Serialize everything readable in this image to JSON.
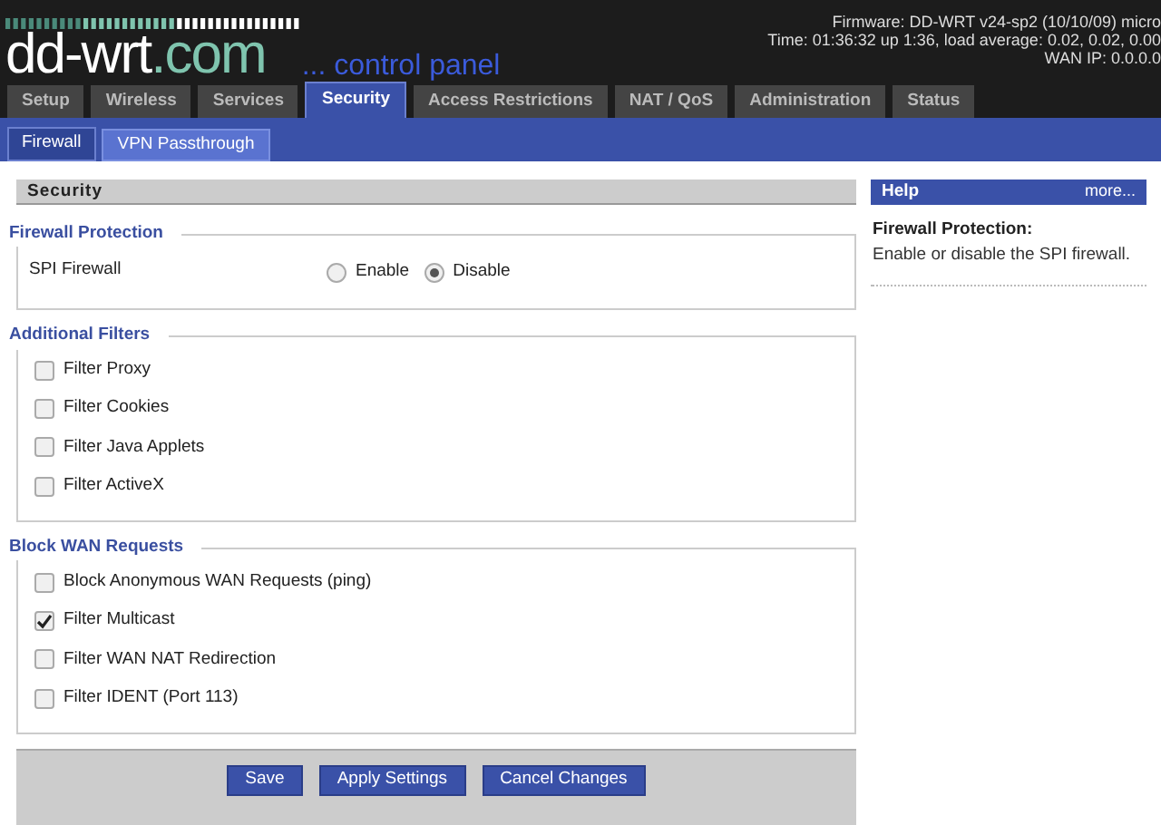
{
  "header": {
    "logo_main": "dd-wrt",
    "logo_suffix": ".com",
    "tagline": "... control panel",
    "info": [
      "Firmware: DD-WRT v24-sp2 (10/10/09) micro",
      "Time: 01:36:32 up 1:36, load average: 0.02, 0.02, 0.00",
      "WAN IP: 0.0.0.0"
    ]
  },
  "tabs": [
    {
      "label": "Setup",
      "selected": false
    },
    {
      "label": "Wireless",
      "selected": false
    },
    {
      "label": "Services",
      "selected": false
    },
    {
      "label": "Security",
      "selected": true
    },
    {
      "label": "Access Restrictions",
      "selected": false
    },
    {
      "label": "NAT / QoS",
      "selected": false
    },
    {
      "label": "Administration",
      "selected": false
    },
    {
      "label": "Status",
      "selected": false
    }
  ],
  "subtabs": [
    {
      "label": "Firewall",
      "selected": true
    },
    {
      "label": "VPN Passthrough",
      "selected": false
    }
  ],
  "section_title": "Security",
  "groups": [
    {
      "legend": "Firewall Protection",
      "kind": "radio",
      "label": "SPI Firewall",
      "options": [
        {
          "label": "Enable",
          "selected": false
        },
        {
          "label": "Disable",
          "selected": true
        }
      ]
    },
    {
      "legend": "Additional Filters",
      "kind": "checkboxes",
      "items": [
        {
          "label": "Filter Proxy",
          "checked": false
        },
        {
          "label": "Filter Cookies",
          "checked": false
        },
        {
          "label": "Filter Java Applets",
          "checked": false
        },
        {
          "label": "Filter ActiveX",
          "checked": false
        }
      ]
    },
    {
      "legend": "Block WAN Requests",
      "kind": "checkboxes",
      "items": [
        {
          "label": "Block Anonymous WAN Requests (ping)",
          "checked": false
        },
        {
          "label": "Filter Multicast",
          "checked": true
        },
        {
          "label": "Filter WAN NAT Redirection",
          "checked": false
        },
        {
          "label": "Filter IDENT (Port 113)",
          "checked": false
        }
      ]
    }
  ],
  "buttons": [
    "Save",
    "Apply Settings",
    "Cancel Changes"
  ],
  "help": {
    "title": "Help",
    "more": "more...",
    "heading": "Firewall Protection:",
    "text": "Enable or disable the SPI firewall."
  }
}
